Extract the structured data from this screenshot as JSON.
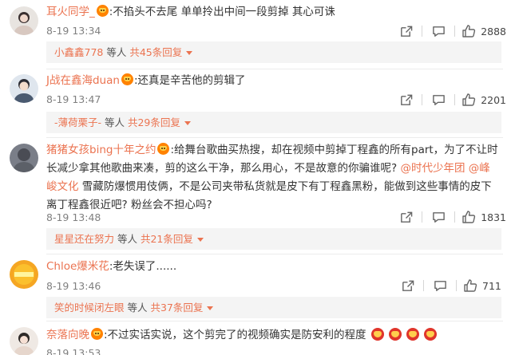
{
  "colors": {
    "accent": "#eb7350",
    "text": "#333333",
    "meta": "#808080",
    "reply_bg": "#f4f4f4"
  },
  "icons": {
    "forward": "share-icon",
    "comment": "comment-icon",
    "like": "thumbs-up-icon"
  },
  "comments": [
    {
      "user": "耳火同学_",
      "text": ":不掐头不去尾 单单拎出中间一段剪掉 其心可诛",
      "time": "8-19 13:34",
      "likes": "2888",
      "reply_user": "小鑫鑫778",
      "reply_mid": " 等人 ",
      "reply_count": "共45条回复"
    },
    {
      "user": "J战在鑫海duan",
      "text": ":还真是辛苦他的剪辑了",
      "time": "8-19 13:47",
      "likes": "2201",
      "reply_user": "-薄荷栗子-",
      "reply_mid": " 等人 ",
      "reply_count": "共29条回复"
    },
    {
      "user": "猪猪女孩bing十年之约",
      "text_a": ":给舞台歌曲买热搜，却在视频中剪掉丁程鑫的所有part，为了不让时长减少拿其他歌曲来凑，剪的这么干净，那么用心，不是故意的你骗谁呢? ",
      "tag1": "@时代少年团",
      "tag2": " @峰峻文化",
      "text_b": " 雪藏防爆惯用伎俩，不是公司夹带私货就是皮下有丁程鑫黑粉，能做到这些事情的皮下离丁程鑫很近吧? 粉丝会不担心吗?",
      "time": "8-19 13:48",
      "likes": "1831",
      "reply_user": "星星还在努力",
      "reply_mid": " 等人 ",
      "reply_count": "共21条回复"
    },
    {
      "user": "Chloe爆米花",
      "text": ":老失误了......",
      "time": "8-19 13:46",
      "likes": "711",
      "reply_user": "笑的时候闭左眼",
      "reply_mid": " 等人 ",
      "reply_count": "共37条回复"
    },
    {
      "user": "奈落向晚",
      "text": ":不过实话实说，这个剪完了的视频确实是防安利的程度",
      "time": "8-19 13:53"
    }
  ]
}
